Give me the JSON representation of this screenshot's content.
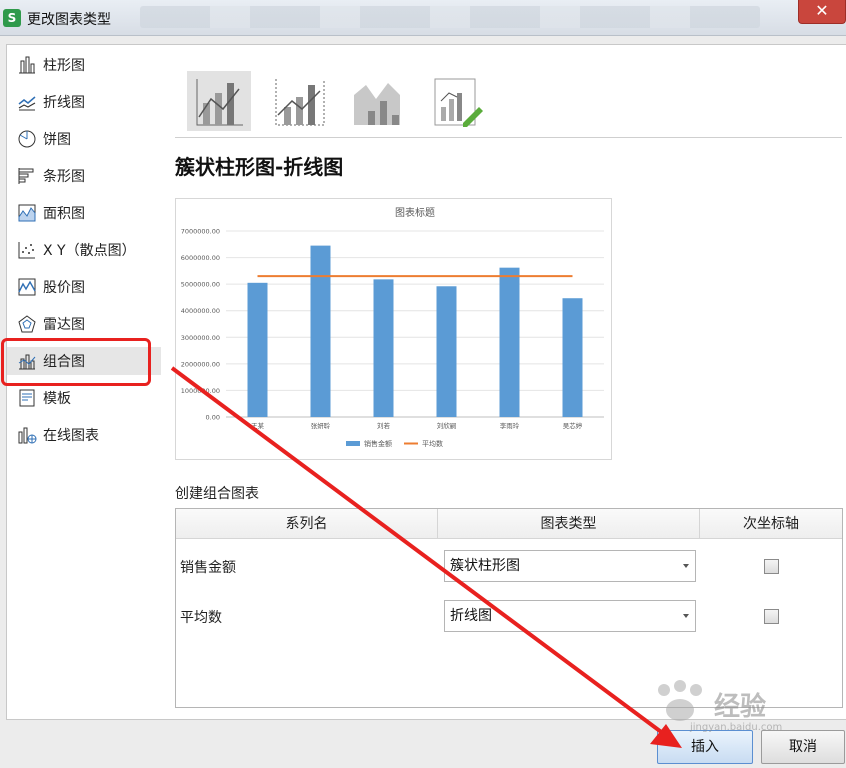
{
  "window": {
    "title": "更改图表类型",
    "app_icon": "S",
    "close_symbol": "✕"
  },
  "sidebar": {
    "items": [
      {
        "label": "柱形图",
        "icon": "column-chart-icon"
      },
      {
        "label": "折线图",
        "icon": "line-chart-icon"
      },
      {
        "label": "饼图",
        "icon": "pie-chart-icon"
      },
      {
        "label": "条形图",
        "icon": "bar-chart-icon"
      },
      {
        "label": "面积图",
        "icon": "area-chart-icon"
      },
      {
        "label": "X Y（散点图）",
        "icon": "scatter-chart-icon"
      },
      {
        "label": "股价图",
        "icon": "stock-chart-icon"
      },
      {
        "label": "雷达图",
        "icon": "radar-chart-icon"
      },
      {
        "label": "组合图",
        "icon": "combo-chart-icon",
        "active": true
      },
      {
        "label": "模板",
        "icon": "template-icon"
      },
      {
        "label": "在线图表",
        "icon": "online-chart-icon"
      }
    ]
  },
  "main": {
    "subtype_title": "簇状柱形图-折线图",
    "thumbnails": [
      "clustered-column-line-icon",
      "clustered-column-line-secondary-icon",
      "stacked-area-column-icon",
      "custom-combo-icon"
    ],
    "combo_section_label": "创建组合图表",
    "table": {
      "headers": [
        "系列名",
        "图表类型",
        "次坐标轴"
      ],
      "rows": [
        {
          "series": "销售金额",
          "chart_type": "簇状柱形图",
          "secondary_axis": false
        },
        {
          "series": "平均数",
          "chart_type": "折线图",
          "secondary_axis": false
        }
      ]
    }
  },
  "buttons": {
    "insert": "插入",
    "cancel": "取消"
  },
  "watermark": {
    "text": "经验",
    "sub": "jingyan.baidu.com"
  },
  "colors": {
    "bar": "#5b9bd5",
    "line": "#ed7d31",
    "highlight": "#e8211f",
    "arrow": "#e8211f"
  },
  "chart_data": {
    "type": "bar",
    "title": "图表标题",
    "categories": [
      "王某",
      "张妍聆",
      "刘若",
      "刘欣嗣",
      "李雨玲",
      "吴芯婷"
    ],
    "series": [
      {
        "name": "销售金额",
        "type": "bar",
        "values": [
          5050000,
          6450000,
          5180000,
          4920000,
          5620000,
          4470000
        ]
      },
      {
        "name": "平均数",
        "type": "line",
        "values": [
          5300000,
          5300000,
          5300000,
          5300000,
          5300000,
          5300000
        ]
      }
    ],
    "yticks": [
      "0.00",
      "1000000.00",
      "2000000.00",
      "3000000.00",
      "4000000.00",
      "5000000.00",
      "6000000.00",
      "7000000.00"
    ],
    "ylim": [
      0,
      7000000
    ],
    "grid": true,
    "legend": "bottom"
  }
}
